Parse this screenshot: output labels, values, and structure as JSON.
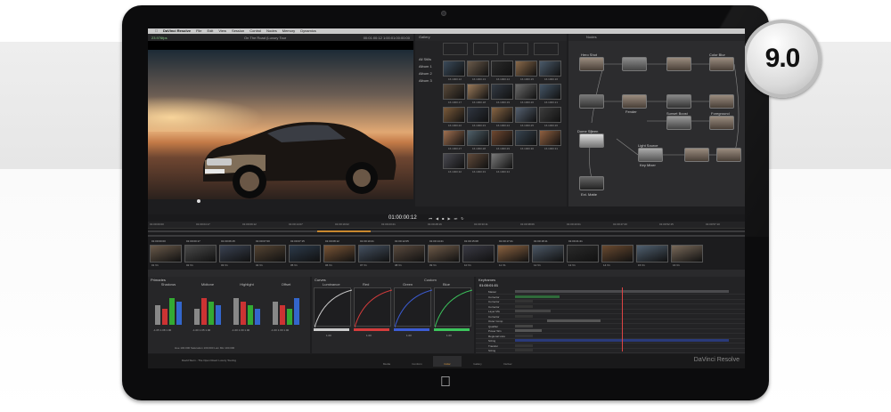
{
  "badge": {
    "version": "9.0"
  },
  "menu": {
    "app_name": "DaVinci Resolve",
    "items": [
      "File",
      "Edit",
      "View",
      "Session",
      "Control",
      "Nodes",
      "Memory",
      "Dynamics"
    ]
  },
  "viewer": {
    "fps": "23.976fps",
    "clip_title": "On The Road (Luxury Tour",
    "timecode_bar": "00:01:00:12  1:00:01:00:00:00",
    "current_timecode": "01:00:00:12"
  },
  "gallery": {
    "title": "Gallery",
    "albums": [
      "All Stills",
      "Album 1",
      "Album 2",
      "Album 3"
    ],
    "stills": [
      "16.1000.12",
      "16.1000.13",
      "16.1000.14",
      "16.1000.15",
      "16.1000.16",
      "16.1000.17",
      "16.1000.18",
      "16.1000.19",
      "16.1000.20",
      "16.1000.21",
      "16.1000.22",
      "16.1000.23",
      "16.1000.24",
      "16.1000.25",
      "16.1000.26",
      "16.1000.27",
      "16.1000.28",
      "16.1000.29",
      "16.1000.30",
      "16.1000.31",
      "16.1000.32",
      "16.1000.33",
      "16.1000.34"
    ]
  },
  "nodes": {
    "title": "Nodes",
    "labels": [
      "Hero Shot",
      "Color Blur",
      "Fender",
      "Sunset Boost",
      "Foreground",
      "Dome Sheen",
      "Light Source",
      "Key Mixer",
      "Ext. Matte"
    ]
  },
  "ruler": {
    "timecodes": [
      "01:00:00:00",
      "01:00:04:17",
      "01:00:09:12",
      "01:00:14:07",
      "01:00:19:02",
      "01:00:23:21",
      "01:00:28:16",
      "01:00:33:11",
      "01:00:38:06",
      "01:00:43:01",
      "01:00:47:20",
      "01:00:52:15",
      "01:00:57:10"
    ]
  },
  "clips": {
    "timecodes": [
      "01:00:00:00",
      "01:00:00:17",
      "01:00:06:15",
      "01:00:07:00",
      "01:00:07:15",
      "01:00:08:12",
      "01:00:10:21",
      "01:00:12:05",
      "01:00:14:21",
      "01:00:15:08",
      "01:00:17:21",
      "01:00:18:11",
      "01:00:21:21"
    ],
    "labels": [
      "01 V1",
      "02 V1",
      "03 V1",
      "04 V1",
      "05 V1",
      "06 V1",
      "07 V1",
      "08 V1",
      "09 V1",
      "10 V1",
      "11 V1",
      "12 V1",
      "13 V1",
      "14 V1",
      "15 V1",
      "16 V1"
    ]
  },
  "primaries": {
    "title": "Primaries",
    "wheels": [
      {
        "label": "Shadows",
        "values": "-1.05  1.08  1.00"
      },
      {
        "label": "Midtone",
        "values": "-1.00  1.05  1.00"
      },
      {
        "label": "Highlight",
        "values": "-1.00  1.00  1.00"
      },
      {
        "label": "Offset",
        "values": "-1.00  1.00  1.00"
      }
    ],
    "footer": "Hue 100.000  Saturation 100.000  Lum Mix 100.000"
  },
  "curves": {
    "title": "Curves",
    "mode": "Custom",
    "channels": [
      "Luminance",
      "Red",
      "Green",
      "Blue"
    ],
    "channel_colors": [
      "#cccccc",
      "#d43c3c",
      "#3c5cd4",
      "#3cc45c"
    ],
    "values": [
      "1.00",
      "1.00",
      "1.00",
      "1.00"
    ]
  },
  "keyframes": {
    "title": "Keyframes",
    "timecode": "01:00:01:01",
    "rows": [
      "Master",
      "Corrector",
      "Corrector",
      "Corrector",
      "Layer Mix",
      "Corrector",
      "Outer Comp",
      "Qualifier",
      "Power Win",
      "Regional Lists",
      "Sizing",
      "Transfer",
      "Sizing"
    ]
  },
  "statusbar": {
    "project": "David Stern - The Open Road: Luxury Touring",
    "pages": [
      "Media",
      "Conform",
      "Color",
      "Gallery",
      "Deliver"
    ],
    "active_page": "Color",
    "brand": "DaVinci Resolve"
  }
}
